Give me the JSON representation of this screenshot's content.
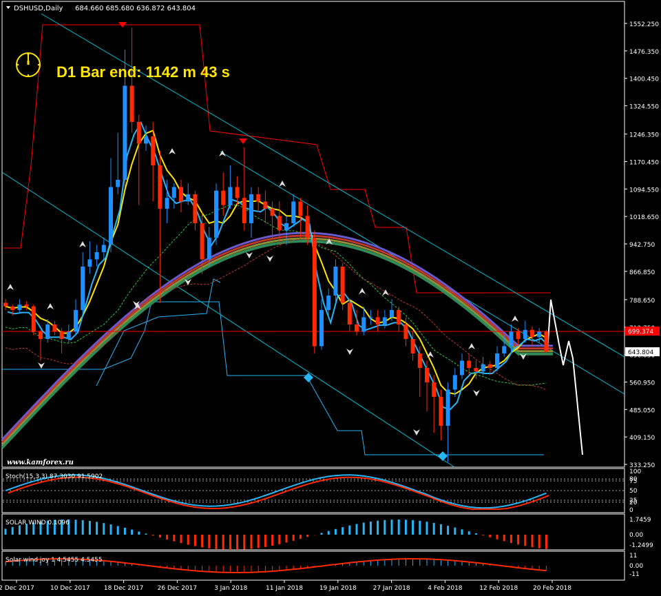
{
  "header": {
    "symbol": "DSHUSD,Daily",
    "ohlc": "684.660 685.680 636.872 643.804"
  },
  "banner": {
    "text": "D1 Bar end: 1142 m 43 s"
  },
  "watermark": {
    "text": "www.kamforex.ru"
  },
  "price_axis": {
    "ticks": [
      "1552.250",
      "1476.350",
      "1400.450",
      "1324.550",
      "1246.350",
      "1170.450",
      "1094.550",
      "1018.650",
      "942.750",
      "866.850",
      "788.650",
      "712.750",
      "636.850",
      "560.950",
      "485.050",
      "409.150",
      "333.250"
    ],
    "tag_red": "699.374",
    "tag_last": "643.804"
  },
  "date_axis": {
    "labels": [
      "2 Dec 2017",
      "10 Dec 2017",
      "18 Dec 2017",
      "26 Dec 2017",
      "3 Jan 2018",
      "11 Jan 2018",
      "19 Jan 2018",
      "27 Jan 2018",
      "4 Feb 2018",
      "12 Feb 2018",
      "20 Feb 2018"
    ]
  },
  "panels": {
    "stoch": {
      "label": "Stoch(15,3,3) 87.3030 91.5902",
      "ticks": [
        "100",
        "80",
        "75",
        "50",
        "25",
        "20",
        "0"
      ]
    },
    "solar": {
      "label": "SOLAR WIND 0.1096",
      "ticks": [
        "1.7459",
        "0.00",
        "-1.2499"
      ]
    },
    "solar_joy": {
      "label": "Solar wind joy 1 4.5455 4.5455",
      "ticks": [
        "11",
        "0.00",
        "-11"
      ]
    }
  },
  "colors": {
    "bull": "#1e90ff",
    "bear": "#ff2a00",
    "bg": "#000000",
    "axis": "#ffffff",
    "channel": "#00bcd4",
    "yellow_ma": "#ffe600",
    "red_line": "#ff0000"
  },
  "chart_data": {
    "type": "candlestick",
    "symbol": "DSHUSD",
    "timeframe": "Daily",
    "ylim": [
      333.25,
      1590
    ],
    "candles": [
      [
        780,
        770,
        790,
        760
      ],
      [
        770,
        760,
        775,
        745
      ],
      [
        760,
        775,
        790,
        750
      ],
      [
        775,
        770,
        785,
        760
      ],
      [
        770,
        700,
        775,
        690
      ],
      [
        700,
        680,
        705,
        620
      ],
      [
        680,
        720,
        735,
        670
      ],
      [
        720,
        700,
        730,
        690
      ],
      [
        700,
        680,
        710,
        640
      ],
      [
        680,
        700,
        720,
        670
      ],
      [
        700,
        760,
        790,
        690
      ],
      [
        760,
        880,
        920,
        750
      ],
      [
        880,
        900,
        950,
        860
      ],
      [
        900,
        920,
        940,
        880
      ],
      [
        920,
        940,
        960,
        900
      ],
      [
        940,
        1100,
        1180,
        920
      ],
      [
        1100,
        1120,
        1250,
        1080
      ],
      [
        1120,
        1380,
        1480,
        1100
      ],
      [
        1380,
        1280,
        1540,
        1250
      ],
      [
        1280,
        1220,
        1300,
        1050
      ],
      [
        1220,
        1240,
        1270,
        1200
      ],
      [
        1240,
        1160,
        1280,
        1060
      ],
      [
        1160,
        1040,
        1200,
        780
      ],
      [
        1040,
        1070,
        1120,
        1000
      ],
      [
        1070,
        1100,
        1110,
        1040
      ],
      [
        1100,
        1060,
        1120,
        1030
      ],
      [
        1060,
        1080,
        1110,
        1050
      ],
      [
        1080,
        1000,
        1090,
        980
      ],
      [
        1000,
        900,
        1030,
        860
      ],
      [
        900,
        960,
        990,
        880
      ],
      [
        960,
        1090,
        1110,
        940
      ],
      [
        1090,
        1050,
        1140,
        1020
      ],
      [
        1050,
        1100,
        1160,
        1040
      ],
      [
        1100,
        1070,
        1130,
        1050
      ],
      [
        1070,
        1000,
        1210,
        980
      ],
      [
        1000,
        1080,
        1100,
        960
      ],
      [
        1080,
        1060,
        1100,
        1030
      ],
      [
        1060,
        1040,
        1090,
        1000
      ],
      [
        1040,
        1020,
        1060,
        960
      ],
      [
        1020,
        980,
        1060,
        940
      ],
      [
        980,
        1000,
        1020,
        940
      ],
      [
        1000,
        1060,
        1080,
        990
      ],
      [
        1060,
        1020,
        1070,
        960
      ],
      [
        1020,
        960,
        1050,
        940
      ],
      [
        960,
        660,
        980,
        640
      ],
      [
        660,
        760,
        790,
        650
      ],
      [
        760,
        800,
        820,
        740
      ],
      [
        800,
        880,
        900,
        780
      ],
      [
        880,
        780,
        890,
        760
      ],
      [
        780,
        720,
        790,
        700
      ],
      [
        720,
        700,
        760,
        690
      ],
      [
        700,
        740,
        770,
        690
      ],
      [
        740,
        740,
        760,
        720
      ],
      [
        740,
        720,
        760,
        700
      ],
      [
        720,
        740,
        760,
        710
      ],
      [
        740,
        760,
        790,
        730
      ],
      [
        760,
        720,
        770,
        700
      ],
      [
        720,
        680,
        740,
        660
      ],
      [
        680,
        640,
        700,
        620
      ],
      [
        640,
        600,
        660,
        520
      ],
      [
        600,
        560,
        620,
        480
      ],
      [
        560,
        520,
        580,
        420
      ],
      [
        520,
        440,
        540,
        400
      ],
      [
        440,
        540,
        560,
        340
      ],
      [
        540,
        580,
        600,
        520
      ],
      [
        580,
        620,
        640,
        570
      ],
      [
        620,
        600,
        640,
        580
      ],
      [
        600,
        590,
        620,
        570
      ],
      [
        590,
        610,
        630,
        580
      ],
      [
        610,
        600,
        620,
        580
      ],
      [
        600,
        640,
        660,
        590
      ],
      [
        640,
        660,
        690,
        630
      ],
      [
        660,
        700,
        720,
        640
      ],
      [
        700,
        680,
        710,
        660
      ],
      [
        680,
        705,
        730,
        670
      ],
      [
        705,
        685,
        715,
        660
      ],
      [
        685,
        700,
        710,
        670
      ],
      [
        700,
        644,
        705,
        636
      ]
    ]
  }
}
